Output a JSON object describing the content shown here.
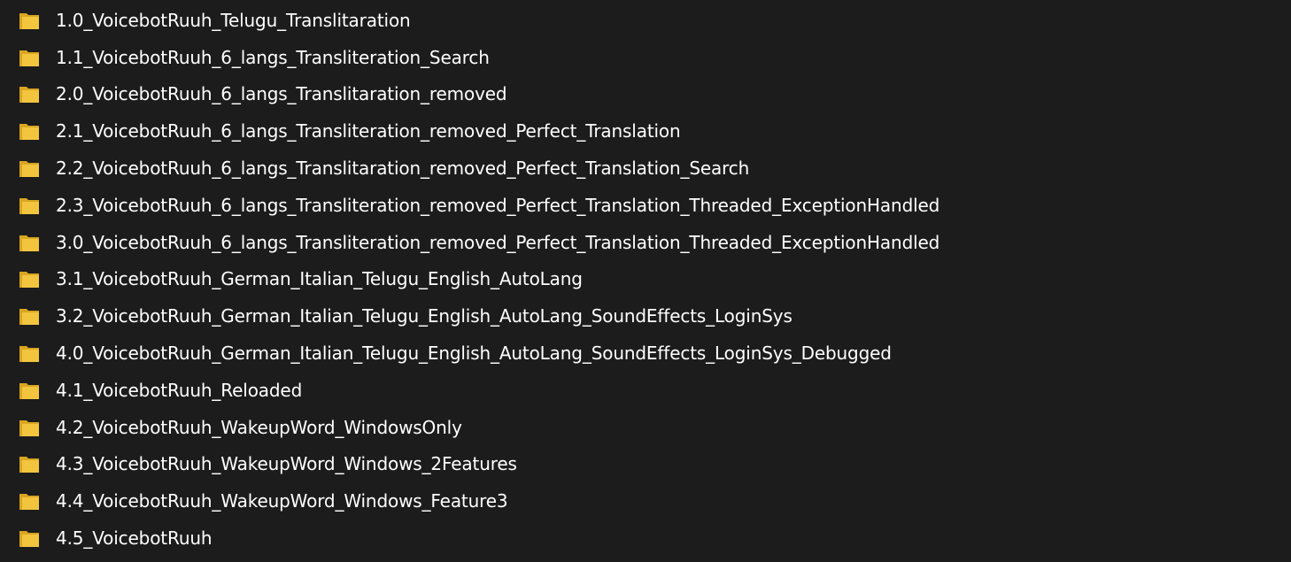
{
  "folder_icon": "folder-icon",
  "colors": {
    "background": "#1c1c1c",
    "text": "#ffffff",
    "folder_front": "#f3c53f",
    "folder_back": "#d9a622"
  },
  "folders": [
    {
      "name": "1.0_VoicebotRuuh_Telugu_Translitaration"
    },
    {
      "name": "1.1_VoicebotRuuh_6_langs_Transliteration_Search"
    },
    {
      "name": "2.0_VoicebotRuuh_6_langs_Translitaration_removed"
    },
    {
      "name": "2.1_VoicebotRuuh_6_langs_Transliteration_removed_Perfect_Translation"
    },
    {
      "name": "2.2_VoicebotRuuh_6_langs_Translitaration_removed_Perfect_Translation_Search"
    },
    {
      "name": "2.3_VoicebotRuuh_6_langs_Transliteration_removed_Perfect_Translation_Threaded_ExceptionHandled"
    },
    {
      "name": "3.0_VoicebotRuuh_6_langs_Transliteration_removed_Perfect_Translation_Threaded_ExceptionHandled"
    },
    {
      "name": "3.1_VoicebotRuuh_German_Italian_Telugu_English_AutoLang"
    },
    {
      "name": "3.2_VoicebotRuuh_German_Italian_Telugu_English_AutoLang_SoundEffects_LoginSys"
    },
    {
      "name": "4.0_VoicebotRuuh_German_Italian_Telugu_English_AutoLang_SoundEffects_LoginSys_Debugged"
    },
    {
      "name": "4.1_VoicebotRuuh_Reloaded"
    },
    {
      "name": "4.2_VoicebotRuuh_WakeupWord_WindowsOnly"
    },
    {
      "name": "4.3_VoicebotRuuh_WakeupWord_Windows_2Features"
    },
    {
      "name": "4.4_VoicebotRuuh_WakeupWord_Windows_Feature3"
    },
    {
      "name": "4.5_VoicebotRuuh"
    }
  ]
}
